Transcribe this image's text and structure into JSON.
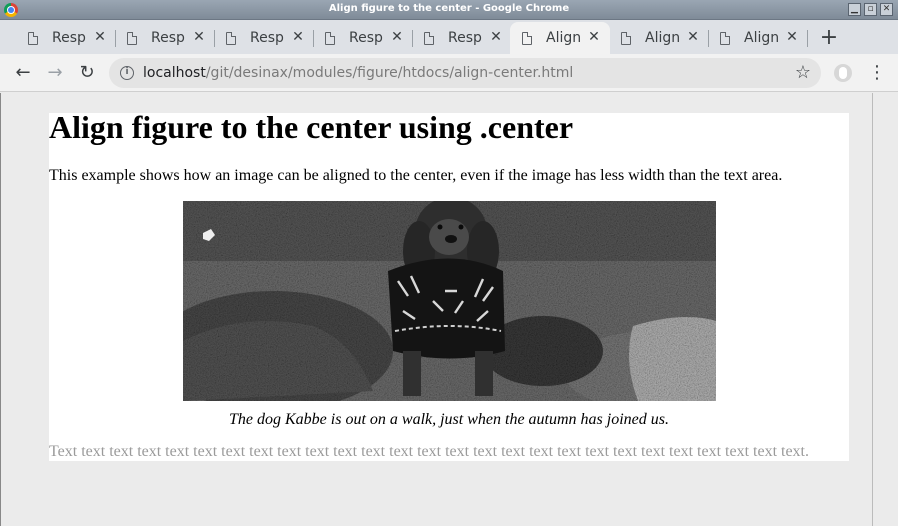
{
  "window": {
    "title": "Align figure to the center - Google Chrome"
  },
  "tabs": [
    {
      "label": "Respons",
      "active": false
    },
    {
      "label": "Respons",
      "active": false
    },
    {
      "label": "Respons",
      "active": false
    },
    {
      "label": "Respons",
      "active": false
    },
    {
      "label": "Respons",
      "active": false
    },
    {
      "label": "Align fig",
      "active": true
    },
    {
      "label": "Align fig",
      "active": false
    },
    {
      "label": "Align fig",
      "active": false
    }
  ],
  "toolbar": {
    "url_host": "localhost",
    "url_path": "/git/desinax/modules/figure/htdocs/align-center.html"
  },
  "page": {
    "heading": "Align figure to the center using .center",
    "intro": "This example shows how an image can be aligned to the center, even if the image has less width than the text area.",
    "caption": "The dog Kabbe is out on a walk, just when the autumn has joined us.",
    "filler": "Text text text text text text text text text text text text text text text text text text text text text text text text text text text."
  },
  "icons": {
    "back": "back-arrow-icon",
    "forward": "forward-arrow-icon",
    "reload": "reload-icon",
    "info": "info-icon",
    "star": "star-icon",
    "menu": "menu-icon"
  }
}
